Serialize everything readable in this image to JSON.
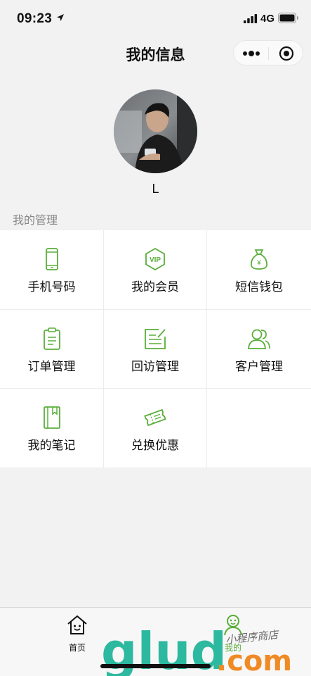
{
  "status_bar": {
    "time": "09:23",
    "network": "4G",
    "icons": [
      "location-arrow-icon",
      "signal-icon",
      "battery-icon"
    ]
  },
  "nav": {
    "title": "我的信息",
    "capsule_icons": [
      "more-icon",
      "close-target-icon"
    ]
  },
  "profile": {
    "username": "L"
  },
  "section": {
    "label": "我的管理"
  },
  "grid_items": [
    {
      "label": "手机号码",
      "icon": "phone-icon"
    },
    {
      "label": "我的会员",
      "icon": "vip-icon"
    },
    {
      "label": "短信钱包",
      "icon": "money-bag-icon"
    },
    {
      "label": "订单管理",
      "icon": "clipboard-icon"
    },
    {
      "label": "回访管理",
      "icon": "edit-note-icon"
    },
    {
      "label": "客户管理",
      "icon": "customers-icon"
    },
    {
      "label": "我的笔记",
      "icon": "notebook-icon"
    },
    {
      "label": "兑换优惠",
      "icon": "coupon-icon"
    }
  ],
  "tabbar": {
    "home_label": "首页",
    "me_label": "我的"
  },
  "watermark": {
    "brand": "glud",
    "suffix": ".com",
    "tagline": "小程序商店"
  },
  "colors": {
    "accent": "#5aae3a",
    "background": "#f2f2f2"
  }
}
